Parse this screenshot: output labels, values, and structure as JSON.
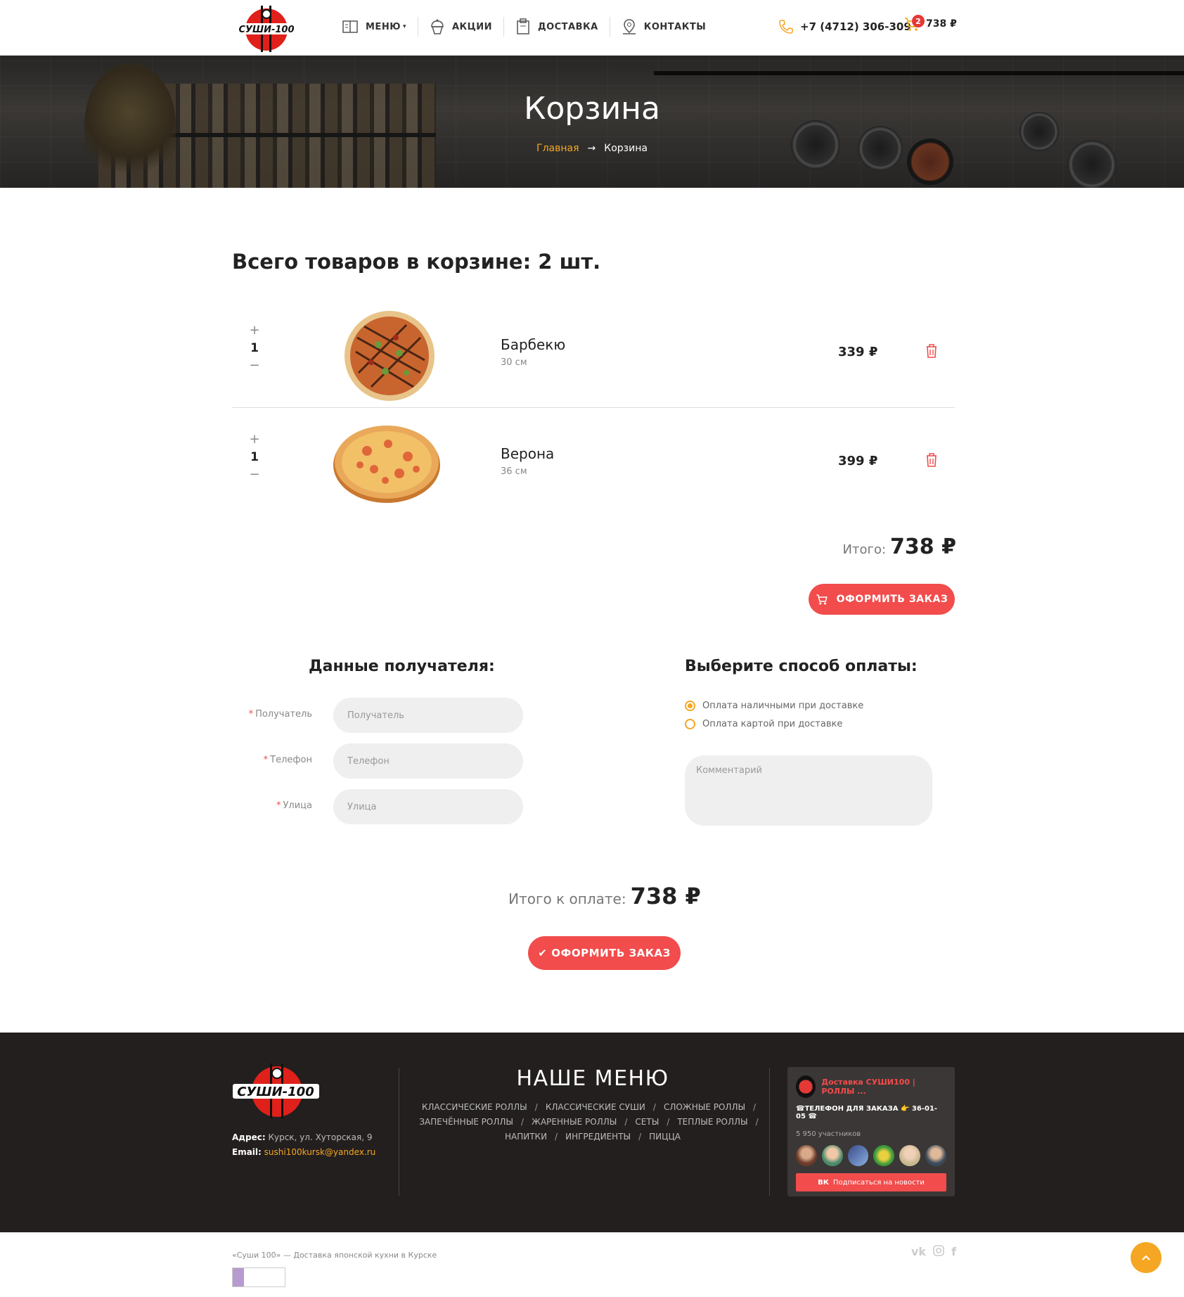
{
  "header": {
    "nav": [
      {
        "label": "МЕНЮ",
        "icon": "menu-book-icon"
      },
      {
        "label": "АКЦИИ",
        "icon": "cupcake-icon"
      },
      {
        "label": "ДОСТАВКА",
        "icon": "delivery-box-icon"
      },
      {
        "label": "КОНТАКТЫ",
        "icon": "map-pin-icon"
      }
    ],
    "phone": "+7 (4712) 306-309",
    "cart_count": "2",
    "cart_total": "738 ₽",
    "logo_text": "СУШИ-100"
  },
  "hero": {
    "title": "Корзина",
    "crumb_home": "Главная",
    "crumb_arrow": "→",
    "crumb_current": "Корзина"
  },
  "cart": {
    "title": "Всего товаров в корзине: 2 шт.",
    "items": [
      {
        "qty": "1",
        "name": "Барбекю",
        "size": "30 см",
        "price": "339 ₽",
        "plus": "+",
        "minus": "−"
      },
      {
        "qty": "1",
        "name": "Верона",
        "size": "36 см",
        "price": "399 ₽",
        "plus": "+",
        "minus": "−"
      }
    ],
    "total_label": "Итого:",
    "total_value": "738 ₽",
    "order_button": "ОФОРМИТЬ ЗАКАЗ"
  },
  "recipient": {
    "title": "Данные получателя:",
    "fields": [
      {
        "label": "Получатель",
        "placeholder": "Получатель"
      },
      {
        "label": "Телефон",
        "placeholder": "Телефон"
      },
      {
        "label": "Улица",
        "placeholder": "Улица"
      }
    ],
    "required_mark": "*"
  },
  "payment": {
    "title": "Выберите способ оплаты:",
    "options": [
      {
        "label": "Оплата наличными при доставке",
        "selected": true
      },
      {
        "label": "Оплата картой при доставке",
        "selected": false
      }
    ],
    "comment_placeholder": "Комментарий"
  },
  "checkout": {
    "total_label": "Итого к оплате:",
    "total_value": "738 ₽",
    "order_button": "ОФОРМИТЬ ЗАКАЗ"
  },
  "footer": {
    "address_label": "Адрес:",
    "address": "Курск, ул. Хуторская, 9",
    "email_label": "Email:",
    "email": "sushi100kursk@yandex.ru",
    "menu_title": "НАШЕ МЕНЮ",
    "menu_links": [
      "КЛАССИЧЕСКИЕ РОЛЛЫ",
      "КЛАССИЧЕСКИЕ СУШИ",
      "СЛОЖНЫЕ РОЛЛЫ",
      "ЗАПЕЧЁННЫЕ РОЛЛЫ",
      "ЖАРЕННЫЕ РОЛЛЫ",
      "СЕТЫ",
      "ТЕПЛЫЕ РОЛЛЫ",
      "НАПИТКИ",
      "ИНГРЕДИЕНТЫ",
      "ПИЦЦА"
    ],
    "vk": {
      "name": "Доставка СУШИ100 | РОЛЛЫ ...",
      "subtitle": "☎ТЕЛЕФОН ДЛЯ ЗАКАЗА 👉 36-01-05 ☎",
      "members": "5 950 участников",
      "subscribe": "Подписаться на новости"
    },
    "copyright": "«Суши 100» — Доставка японской кухни в Курске",
    "social": [
      "vk",
      "instagram",
      "facebook"
    ]
  },
  "colors": {
    "accent": "#f24c4c",
    "orange": "#f5a623",
    "footer_bg": "#231f1e"
  }
}
